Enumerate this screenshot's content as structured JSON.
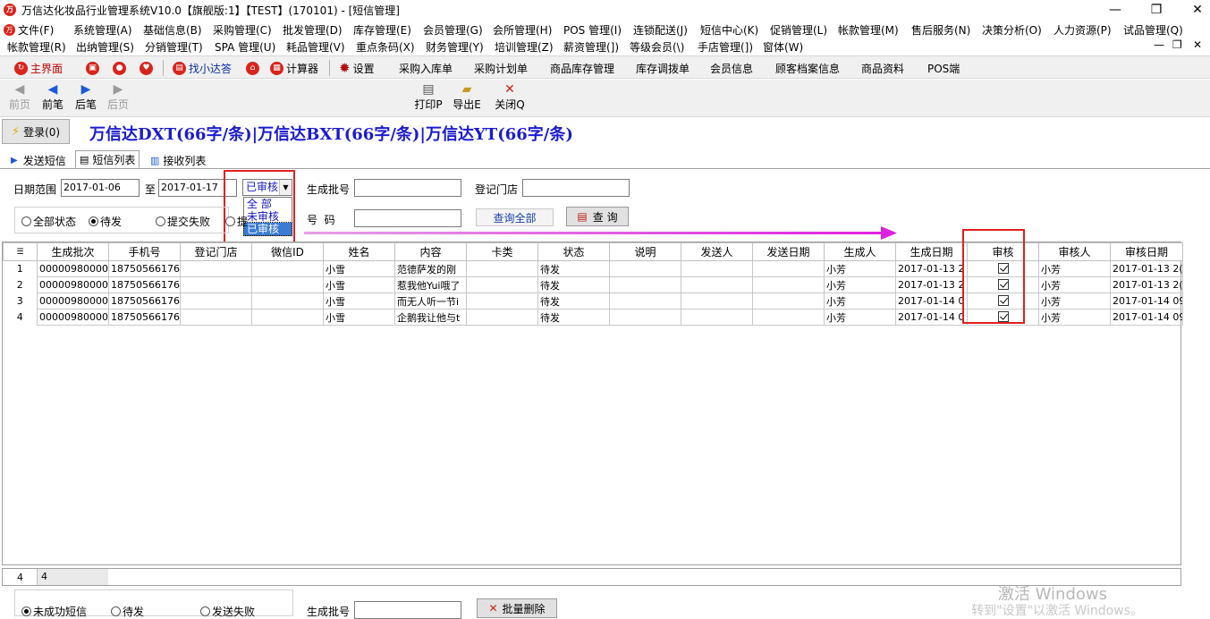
{
  "window": {
    "title": "万信达化妆品行业管理系统V10.0【旗舰版:1】【TEST】(170101) - [短信管理]",
    "logo_text": "万",
    "minimize": "—",
    "restore": "❐",
    "close": "✕"
  },
  "menu1": [
    "文件(F)",
    "系统管理(A)",
    "基础信息(B)",
    "采购管理(C)",
    "批发管理(D)",
    "库存管理(E)",
    "会员管理(G)",
    "会所管理(H)",
    "POS 管理(I)",
    "连锁配送(J)",
    "短信中心(K)",
    "促销管理(L)",
    "帐款管理(M)",
    "售后服务(N)",
    "决策分析(O)",
    "人力资源(P)",
    "试品管理(Q)"
  ],
  "menu2": [
    "帐款管理(R)",
    "出纳管理(S)",
    "分销管理(T)",
    "SPA 管理(U)",
    "耗品管理(V)",
    "重点条码(X)",
    "财务管理(Y)",
    "培训管理(Z)",
    "薪资管理(])",
    "等级会员(\\)",
    "手店管理(])",
    "窗体(W)"
  ],
  "mdi_controls": [
    "—",
    "❐",
    "✕"
  ],
  "toolbar1": {
    "home": "主界面",
    "find": "找小达答",
    "calc": "计算器",
    "settings": "设置",
    "links": [
      "采购入库单",
      "采购计划单",
      "商品库存管理",
      "库存调拨单",
      "会员信息",
      "顾客档案信息",
      "商品资料",
      "POS端"
    ]
  },
  "toolbar2": {
    "first": "前页",
    "prev": "前笔",
    "next": "后笔",
    "last": "后页",
    "print": "打印P",
    "export": "导出E",
    "close": "关闭Q"
  },
  "login_button": "登录(0)",
  "banner": "万信达DXT(66字/条)|万信达BXT(66字/条)|万信达YT(66字/条)",
  "tabs": [
    "发送短信",
    "短信列表",
    "接收列表"
  ],
  "filter": {
    "date_label": "日期范围",
    "date_from": "2017-01-06",
    "date_to_label": "至",
    "date_to": "2017-01-17",
    "status_selected": "已审核",
    "status_options": [
      "全 部",
      "未审核",
      "已审核"
    ],
    "batch_label": "生成批号",
    "batch_value": "",
    "store_label": "登记门店",
    "store_value": "",
    "phone_label": "号  码",
    "phone_value": "",
    "query_all": "查询全部",
    "query": "查 询",
    "radios": [
      {
        "label": "全部状态",
        "checked": false
      },
      {
        "label": "待发",
        "checked": true
      },
      {
        "label": "提交失败",
        "checked": false
      },
      {
        "label": "提",
        "checked": false
      }
    ]
  },
  "grid": {
    "columns": [
      "生成批次",
      "手机号",
      "登记门店",
      "微信ID",
      "姓名",
      "内容",
      "卡类",
      "状态",
      "说明",
      "发送人",
      "发送日期",
      "生成人",
      "生成日期",
      "审核",
      "审核人",
      "审核日期"
    ],
    "rows": [
      {
        "n": "1",
        "batch": "000009800000(",
        "phone": "18750566176",
        "store": "",
        "wx": "",
        "name": "小雪",
        "content": "范德萨发的刚",
        "card": "",
        "status": "待发",
        "note": "",
        "sender": "",
        "senddate": "",
        "creator": "小芳",
        "cdate": "2017-01-13 2",
        "audited": true,
        "auditor": "小芳",
        "adate": "2017-01-13 2("
      },
      {
        "n": "2",
        "batch": "000009800000(",
        "phone": "18750566176",
        "store": "",
        "wx": "",
        "name": "小雪",
        "content": "惹我他Yui哦了",
        "card": "",
        "status": "待发",
        "note": "",
        "sender": "",
        "senddate": "",
        "creator": "小芳",
        "cdate": "2017-01-13 2",
        "audited": true,
        "auditor": "小芳",
        "adate": "2017-01-13 2("
      },
      {
        "n": "3",
        "batch": "000009800000(",
        "phone": "18750566176",
        "store": "",
        "wx": "",
        "name": "小雪",
        "content": "而无人听一节i",
        "card": "",
        "status": "待发",
        "note": "",
        "sender": "",
        "senddate": "",
        "creator": "小芳",
        "cdate": "2017-01-14 0",
        "audited": true,
        "auditor": "小芳",
        "adate": "2017-01-14 09"
      },
      {
        "n": "4",
        "batch": "000009800000(",
        "phone": "18750566176",
        "store": "",
        "wx": "",
        "name": "小雪",
        "content": "企鹅我让他与t",
        "card": "",
        "status": "待发",
        "note": "",
        "sender": "",
        "senddate": "",
        "creator": "小芳",
        "cdate": "2017-01-14 0",
        "audited": true,
        "auditor": "小芳",
        "adate": "2017-01-14 09"
      }
    ]
  },
  "footer": {
    "count_left": "4",
    "count_right": "4"
  },
  "bottom": {
    "radios": [
      {
        "label": "未成功短信",
        "checked": true
      },
      {
        "label": "待发",
        "checked": false
      },
      {
        "label": "发送失败",
        "checked": false
      }
    ],
    "batch_label": "生成批号",
    "batch_delete": "批量删除"
  },
  "watermark": {
    "line1": "激活 Windows",
    "line2": "转到\"设置\"以激活 Windows。"
  },
  "colors": {
    "accent_red": "#e02020",
    "banner_blue": "#1b1bd0",
    "arrow_magenta": "#e020e0"
  }
}
